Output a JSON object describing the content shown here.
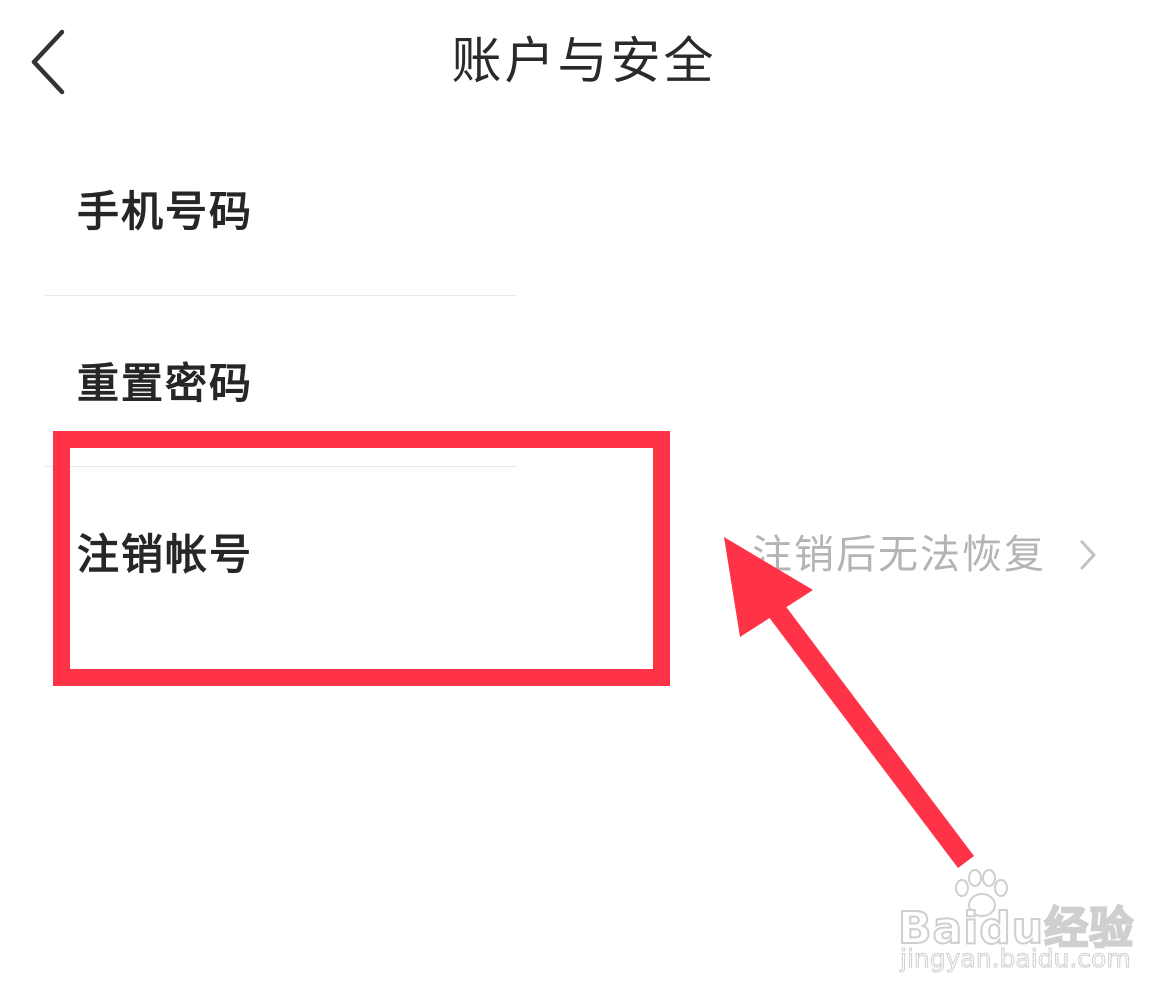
{
  "header": {
    "title": "账户与安全",
    "back_icon": "chevron-left-icon"
  },
  "rows": [
    {
      "label": "手机号码"
    },
    {
      "label": "重置密码"
    },
    {
      "label": "注销帐号",
      "hint": "注销后无法恢复",
      "trailing_icon": "chevron-right-icon"
    }
  ],
  "annotation": {
    "highlight_color": "#ff3347",
    "arrow_color": "#ff3347"
  },
  "watermark": {
    "logo_text": "Baidu经验",
    "url_text": "jingyan.baidu.com"
  },
  "colors": {
    "text_primary": "#262626",
    "text_hint": "#b4b4b4",
    "divider": "#e9e9e9",
    "background": "#ffffff"
  }
}
